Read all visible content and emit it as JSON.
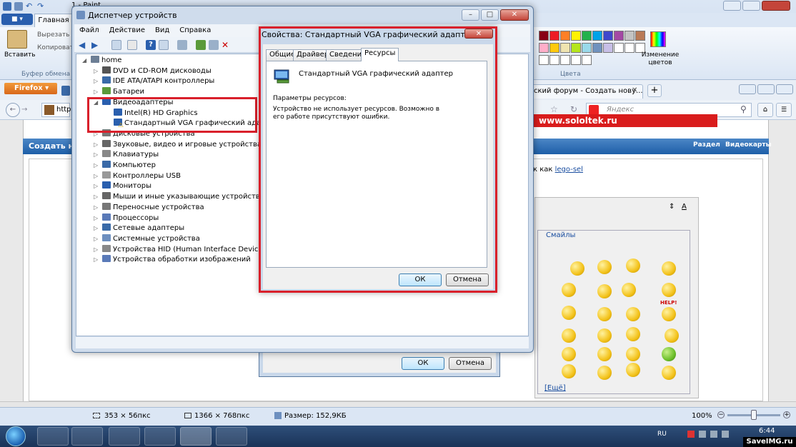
{
  "paint": {
    "title": "1 - Paint",
    "file_tab": "■ ▾",
    "home_tab": "Главная",
    "paste_label": "Вставить",
    "cut_label": "Вырезать",
    "copy_label": "Копировать",
    "clipboard_group": "Буфер обмена",
    "colors_group": "Цвета",
    "edit_colors": "Изменение цветов",
    "palette": [
      "#880015",
      "#ed1c24",
      "#ff7f27",
      "#fff200",
      "#22b14c",
      "#00a2e8",
      "#3f48cc",
      "#a349a4",
      "#c3c3c3",
      "#b97a57",
      "#ffaec9",
      "#ffc90e",
      "#efe4b0",
      "#b5e61d",
      "#99d9ea",
      "#7092be",
      "#c8bfe7",
      "#ffffff",
      "#ffffff",
      "#ffffff",
      "#ffffff",
      "#ffffff",
      "#ffffff",
      "#ffffff",
      "#ffffff"
    ]
  },
  "firefox": {
    "button": "Firefox ▾",
    "tab_text": "ский форум - Создать нову...",
    "tab_close": "✕",
    "new_tab": "+",
    "url_prefix": "http",
    "search_placeholder": "Яндекс"
  },
  "webpage": {
    "header": "Создать н",
    "section_label": "Раздел",
    "section_value": "Видеокарты",
    "as_text": "к как",
    "link": "lego-sel",
    "smileys_legend": "Смайлы",
    "more_link": "[Ещё]",
    "banner": "www.sololtek.ru",
    "help_label": "HELP!"
  },
  "status": {
    "selection_size": "353 × 56пкс",
    "image_size": "1366 × 768пкс",
    "file_size": "Размер: 152,9КБ",
    "zoom": "100%",
    "zoom_fraction": 0.5
  },
  "taskbar": {
    "lang": "RU",
    "time": "6:44",
    "watermark": "SaveIMG.ru"
  },
  "device_manager": {
    "title": "Диспетчер устройств",
    "menu": [
      "Файл",
      "Действие",
      "Вид",
      "Справка"
    ],
    "tree": [
      {
        "label": "home",
        "level": 0,
        "expanded": true
      },
      {
        "label": "DVD и CD-ROM дисководы",
        "level": 1
      },
      {
        "label": "IDE ATA/ATAPI контроллеры",
        "level": 1
      },
      {
        "label": "Батареи",
        "level": 1
      },
      {
        "label": "Видеоадаптеры",
        "level": 1,
        "expanded": true
      },
      {
        "label": "Intel(R) HD Graphics",
        "level": 2
      },
      {
        "label": "Стандартный VGA графический адаптер",
        "level": 2,
        "warning": true
      },
      {
        "label": "Дисковые устройства",
        "level": 1
      },
      {
        "label": "Звуковые, видео и игровые устройства",
        "level": 1
      },
      {
        "label": "Клавиатуры",
        "level": 1
      },
      {
        "label": "Компьютер",
        "level": 1
      },
      {
        "label": "Контроллеры USB",
        "level": 1
      },
      {
        "label": "Мониторы",
        "level": 1
      },
      {
        "label": "Мыши и иные указывающие устройства",
        "level": 1
      },
      {
        "label": "Переносные устройства",
        "level": 1
      },
      {
        "label": "Процессоры",
        "level": 1
      },
      {
        "label": "Сетевые адаптеры",
        "level": 1
      },
      {
        "label": "Системные устройства",
        "level": 1
      },
      {
        "label": "Устройства HID (Human Interface Devices)",
        "level": 1
      },
      {
        "label": "Устройства обработки изображений",
        "level": 1
      }
    ]
  },
  "dialog": {
    "title": "Свойства: Стандартный VGA графический адаптер",
    "close": "✕",
    "tabs": [
      "Общие",
      "Драйвер",
      "Сведения",
      "Ресурсы"
    ],
    "active_tab": "Ресурсы",
    "device_name": "Стандартный VGA графический адаптер",
    "resources_label": "Параметры ресурсов:",
    "resources_message": "Устройство не использует ресурсов. Возможно в его работе присутствуют ошибки.",
    "ok": "ОК",
    "cancel": "Отмена"
  },
  "dialog_back": {
    "ok": "ОК",
    "cancel": "Отмена"
  }
}
